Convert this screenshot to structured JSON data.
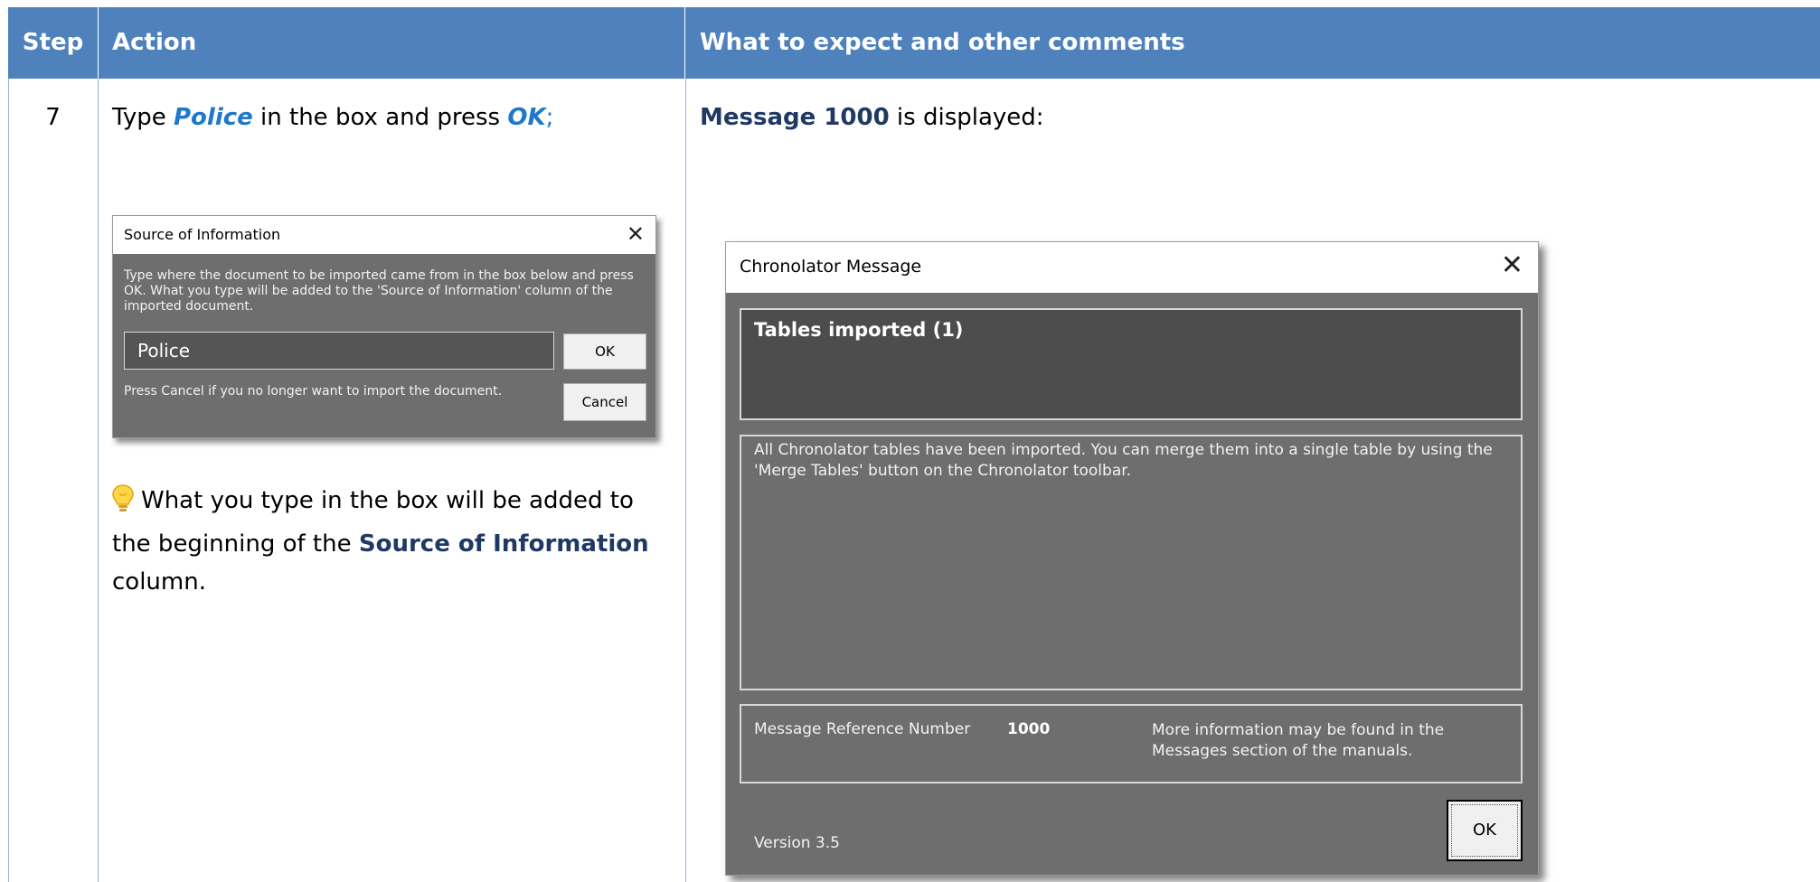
{
  "table": {
    "headers": {
      "step": "Step",
      "action": "Action",
      "expect": "What to expect and other comments"
    },
    "row": {
      "step": "7",
      "action": {
        "prefix": "Type ",
        "keyword1": "Police",
        "middle": " in the box and press ",
        "keyword2": "OK",
        "suffix": ";"
      },
      "tip": {
        "icon": "lightbulb-icon",
        "text1": "What you type in the box will be added to the beginning of the ",
        "strong": "Source of Information",
        "text2": " column."
      },
      "expect": {
        "strong": "Message 1000",
        "text": " is displayed:"
      }
    }
  },
  "source_dialog": {
    "title": "Source of Information",
    "close_icon": "close-icon",
    "description": "Type where the document to be imported came from in the box below and press OK. What you type will be added to the 'Source of Information' column of the imported document.",
    "input_value": "Police",
    "ok_label": "OK",
    "note": "Press Cancel if you no longer want to import the document.",
    "cancel_label": "Cancel"
  },
  "message_dialog": {
    "title": "Chronolator Message",
    "close_icon": "close-icon",
    "heading": "Tables imported (1)",
    "body": "All Chronolator tables have been imported. You can merge them into a single table by using the 'Merge Tables' button on the Chronolator toolbar.",
    "ref_label": "Message Reference Number",
    "ref_number": "1000",
    "more_info": "More information may be found in the Messages section of the manuals.",
    "version": "Version 3.5",
    "ok_label": "OK"
  },
  "colors": {
    "header_bg": "#4f81bd",
    "keyword": "#1f78c8",
    "strong_text": "#1f3864",
    "dialog_bg": "#6e6e6e"
  }
}
